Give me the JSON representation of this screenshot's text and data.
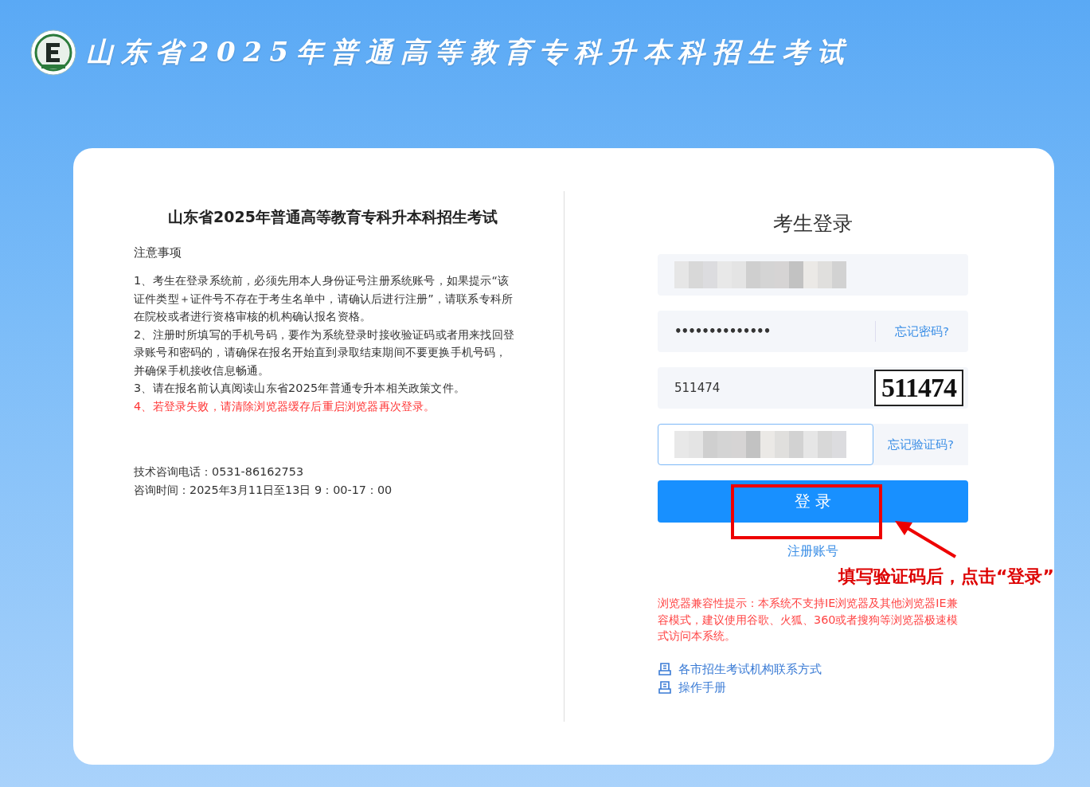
{
  "header": {
    "title": "山东省2025年普通高等教育专科升本科招生考试"
  },
  "notice": {
    "title": "山东省2025年普通高等教育专科升本科招生考试",
    "heading": "注意事项",
    "items": [
      {
        "text": "1、考生在登录系统前，必须先用本人身份证号注册系统账号，如果提示“该证件类型＋证件号不存在于考生名单中，请确认后进行注册”，请联系专科所在院校或者进行资格审核的机构确认报名资格。",
        "important": false
      },
      {
        "text": "2、注册时所填写的手机号码，要作为系统登录时接收验证码或者用来找回登录账号和密码的，请确保在报名开始直到录取结束期间不要更换手机号码，并确保手机接收信息畅通。",
        "important": false
      },
      {
        "text": "3、请在报名前认真阅读山东省2025年普通专升本相关政策文件。",
        "important": false
      },
      {
        "text": "4、若登录失败，请清除浏览器缓存后重启浏览器再次登录。",
        "important": true
      }
    ],
    "contact": [
      "技术咨询电话：0531-86162753",
      "咨询时间：2025年3月11日至13日 9：00-17：00"
    ]
  },
  "login": {
    "title": "考生登录",
    "fields": [
      {
        "kind": "redacted",
        "focused": false
      },
      {
        "kind": "password",
        "value": "••••••••••••••",
        "link": "忘记密码?"
      },
      {
        "kind": "captcha",
        "value": "511474",
        "captcha": "511474"
      },
      {
        "kind": "redacted",
        "focused": true,
        "link": "忘记验证码?"
      }
    ],
    "button": "登 录",
    "register": "注册账号",
    "compat": "浏览器兼容性提示：本系统不支持IE浏览器及其他浏览器IE兼容模式，建议使用谷歌、火狐、360或者搜狗等浏览器极速模式访问本系统。",
    "links": [
      "各市招生考试机构联系方式",
      "操作手册"
    ]
  },
  "annotation": {
    "text": "填写验证码后，点击“登录”"
  }
}
